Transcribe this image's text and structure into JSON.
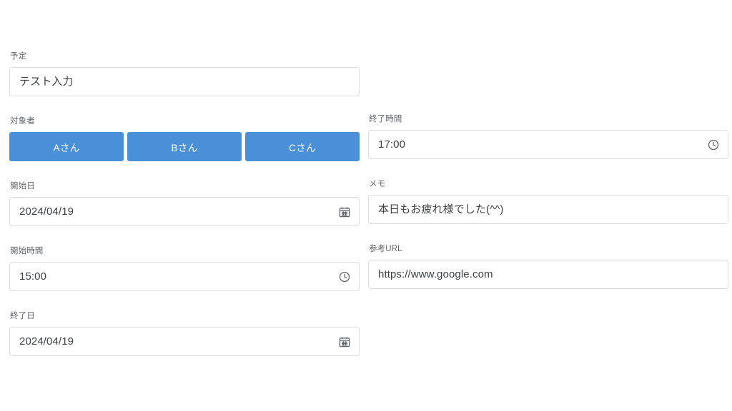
{
  "form": {
    "left_column": [
      {
        "key": "schedule",
        "label": "予定",
        "value": "テスト入力",
        "placeholder": "",
        "icon": ""
      },
      {
        "key": "target_people",
        "label": "対象者",
        "buttons": [
          {
            "label": "Aさん"
          },
          {
            "label": "Bさん"
          },
          {
            "label": "Cさん"
          }
        ]
      },
      {
        "key": "start_date",
        "label": "開始日",
        "value": "2024/04/19",
        "placeholder": "",
        "icon": "calendar-icon"
      },
      {
        "key": "start_time",
        "label": "開始時間",
        "value": "15:00",
        "placeholder": "",
        "icon": "clock-icon"
      },
      {
        "key": "end_date",
        "label": "終了日",
        "value": "2024/04/19",
        "placeholder": "",
        "icon": "calendar-icon"
      }
    ],
    "right_column": [
      {
        "key": "end_time",
        "label": "終了時間",
        "value": "17:00",
        "placeholder": "",
        "icon": "clock-icon"
      },
      {
        "key": "memo",
        "label": "メモ",
        "value": "本日もお疲れ様でした(^^)",
        "placeholder": "",
        "icon": ""
      },
      {
        "key": "reference_url",
        "label": "参考URL",
        "value": "https://www.google.com",
        "placeholder": "",
        "icon": ""
      }
    ]
  },
  "colors": {
    "button_blue": "#4a90d9",
    "button_text": "#ffffff",
    "label_text": "#5f6368",
    "value_text": "#3c4043",
    "input_border": "#dcdee1",
    "background": "#ffffff",
    "icon": "#5f6368"
  }
}
